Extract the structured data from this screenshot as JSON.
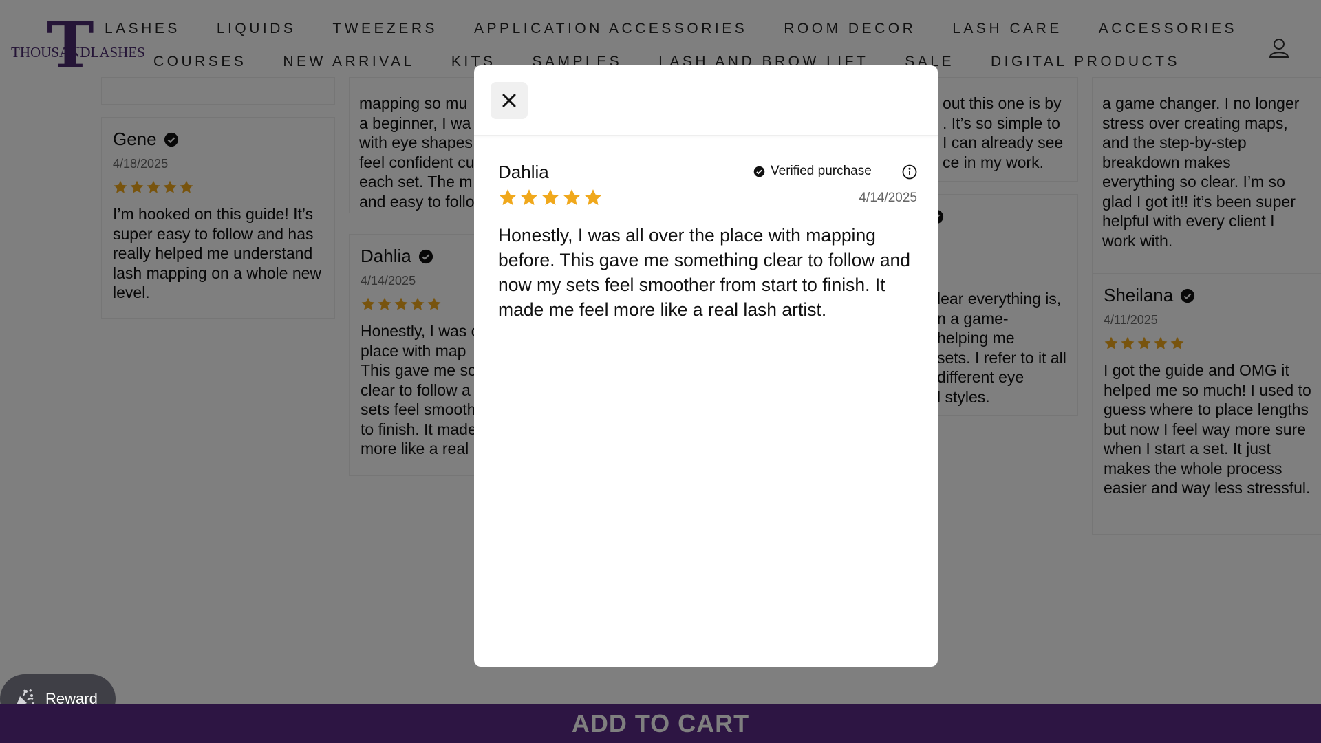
{
  "brand": {
    "logo_letter": "T",
    "logo_text": "THOUSANDLASHES"
  },
  "nav": {
    "row1": [
      "LASHES",
      "LIQUIDS",
      "TWEEZERS",
      "APPLICATION ACCESSORIES",
      "ROOM DECOR",
      "LASH CARE",
      "ACCESSORIES"
    ],
    "row2": [
      "COURSES",
      "NEW ARRIVAL",
      "KITS",
      "SAMPLES",
      "LASH AND BROW LIFT",
      "SALE",
      "DIGITAL PRODUCTS"
    ]
  },
  "colors": {
    "star": "#f0a81c",
    "brand_purple": "#5b2a86",
    "overlay": "rgba(0,0,0,0.5)"
  },
  "reviews": {
    "gene": {
      "name": "Gene",
      "date": "4/18/2025",
      "rating": 5,
      "text": "I’m hooked on this guide! It’s super easy to follow and has really helped me understand lash mapping on a whole new level."
    },
    "dahlia": {
      "name": "Dahlia",
      "date": "4/14/2025",
      "rating": 5
    },
    "sheilana": {
      "name": "Sheilana",
      "date": "4/11/2025",
      "rating": 5,
      "text": "I got the guide and OMG it helped me so much! I used to guess where to place lengths but now I feel way more sure when I start a set. It just makes the whole process easier and way less stressful."
    },
    "col2_top_lines": [
      "mapping so mu",
      "a beginner, I wa",
      "with eye shapes",
      "feel confident cu",
      "each set. The m",
      "and easy to follo"
    ],
    "col2_dahlia_lines": [
      "Honestly, I was c",
      "place with map",
      "This gave me so",
      "clear to follow a",
      "sets feel smooth",
      "to finish. It made",
      "more like a real"
    ],
    "col4_top_lines": [
      "out this one is by",
      ". It’s so simple to",
      "I can already see",
      "ce in my work."
    ],
    "col4_mid_lines": [
      "lear everything is,",
      "n a game-",
      "helping me",
      "sets. I refer to it all",
      "different eye",
      "l styles."
    ],
    "col5_top_lines": [
      "a game changer. I no longer",
      "stress over creating maps,",
      "and the step-by-step",
      "breakdown makes",
      "everything so clear. I’m so",
      "glad I got it!! it’s been super",
      "helpful with every client I",
      "work with."
    ]
  },
  "modal": {
    "name": "Dahlia",
    "verified": "Verified purchase",
    "date": "4/14/2025",
    "rating": 5,
    "body": "Honestly, I was all over the place with mapping before. This gave me something clear to follow and now my sets feel smoother from start to finish. It made me feel more like a real lash artist."
  },
  "reward": {
    "label": "Reward"
  },
  "cart": {
    "label": "ADD TO CART"
  }
}
